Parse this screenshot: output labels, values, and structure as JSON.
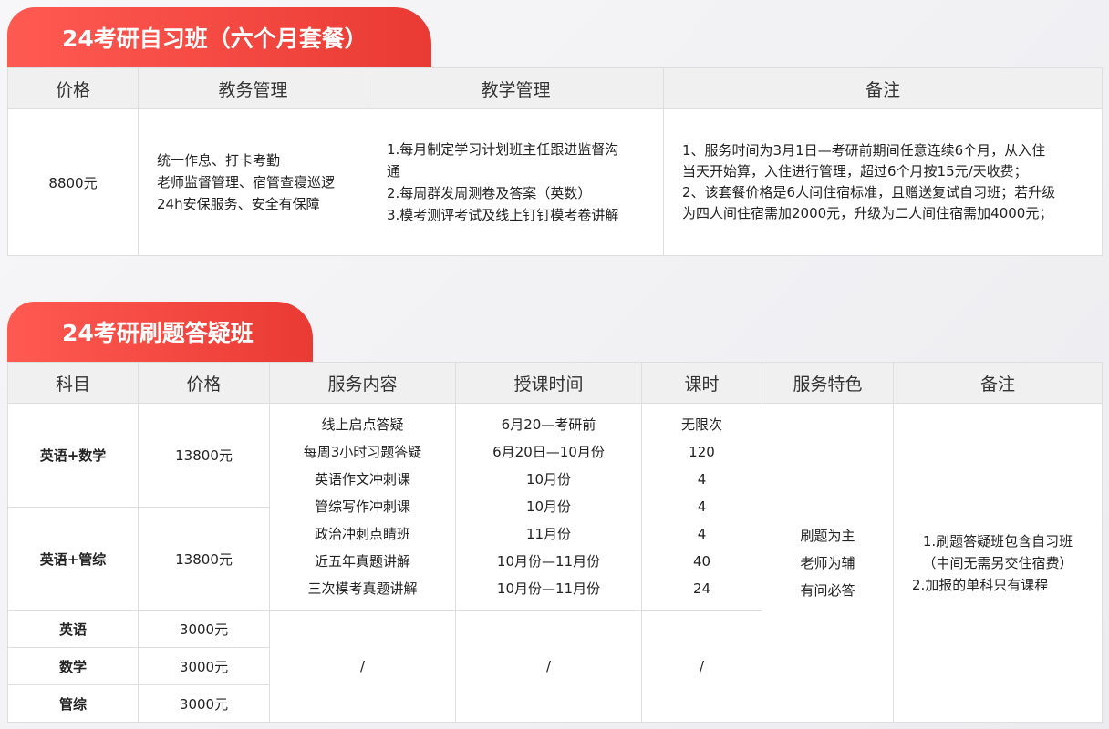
{
  "section1": {
    "title": "24考研自习班（六个月套餐）",
    "headers": [
      "价格",
      "教务管理",
      "教学管理",
      "备注"
    ],
    "price": "8800元",
    "admin": [
      "统一作息、打卡考勤",
      "老师监督管理、宿管查寝巡逻",
      "24h安保服务、安全有保障"
    ],
    "teaching": [
      "1.每月制定学习计划班主任跟进监督沟",
      "通",
      "2.每周群发周测卷及答案（英数）",
      "3.模考测评考试及线上钉钉模考卷讲解"
    ],
    "remarks": [
      "1、服务时间为3月1日—考研前期间任意连续6个月，从入住",
      "当天开始算，入住进行管理，超过6个月按15元/天收费；",
      "2、该套餐价格是6人间住宿标准，且赠送复试自习班；若升级",
      "为四人间住宿需加2000元，升级为二人间住宿需加4000元；"
    ]
  },
  "section2": {
    "title": "24考研刷题答疑班",
    "headers": [
      "科目",
      "价格",
      "服务内容",
      "授课时间",
      "课时",
      "服务特色",
      "备注"
    ],
    "rows": [
      {
        "subject": "英语+数学",
        "price": "13800元"
      },
      {
        "subject": "英语+管综",
        "price": "13800元"
      },
      {
        "subject": "英语",
        "price": "3000元"
      },
      {
        "subject": "数学",
        "price": "3000元"
      },
      {
        "subject": "管综",
        "price": "3000元"
      }
    ],
    "services": [
      "线上启点答疑",
      "每周3小时习题答疑",
      "英语作文冲刺课",
      "管综写作冲刺课",
      "政治冲刺点睛班",
      "近五年真题讲解",
      "三次模考真题讲解"
    ],
    "times": [
      "6月20—考研前",
      "6月20日—10月份",
      "10月份",
      "10月份",
      "11月份",
      "10月份—11月份",
      "10月份—11月份"
    ],
    "hours": [
      "无限次",
      "120",
      "4",
      "4",
      "4",
      "40",
      "24"
    ],
    "features": [
      "刷题为主",
      "老师为辅",
      "有问必答"
    ],
    "remarks": [
      "1.刷题答疑班包含自习班",
      "（中间无需另交住宿费）",
      "2.加报的单科只有课程"
    ],
    "slash": "/"
  }
}
